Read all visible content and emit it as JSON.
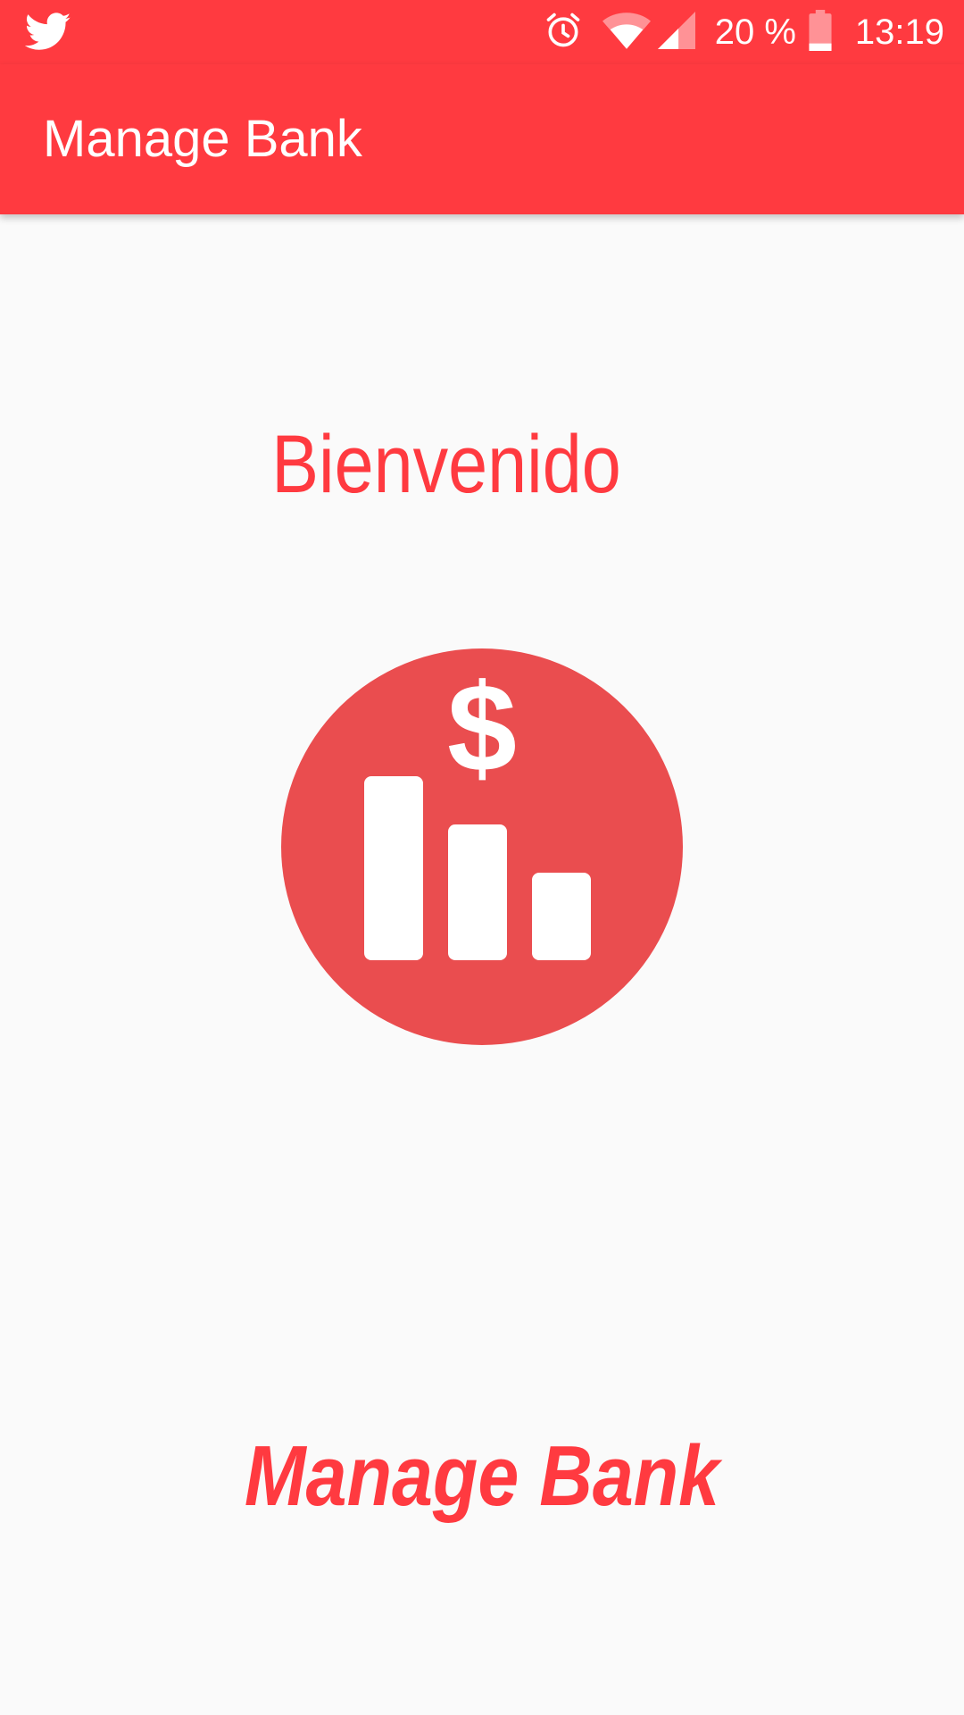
{
  "status_bar": {
    "notification_icon": "twitter-bird-icon",
    "icons": [
      "alarm-clock-icon",
      "wifi-icon",
      "cell-signal-icon",
      "battery-icon"
    ],
    "battery_percent": "20 %",
    "battery_level": 0.2,
    "time": "13:19"
  },
  "app_bar": {
    "title": "Manage Bank"
  },
  "main": {
    "welcome_text": "Bienvenido",
    "logo_icon": "bank-chart-dollar-icon",
    "footer_brand": "Manage Bank"
  },
  "colors": {
    "primary": "#ff3a40",
    "logo_circle": "#ea4d4f",
    "background": "#fafafa",
    "on_primary": "#ffffff"
  }
}
